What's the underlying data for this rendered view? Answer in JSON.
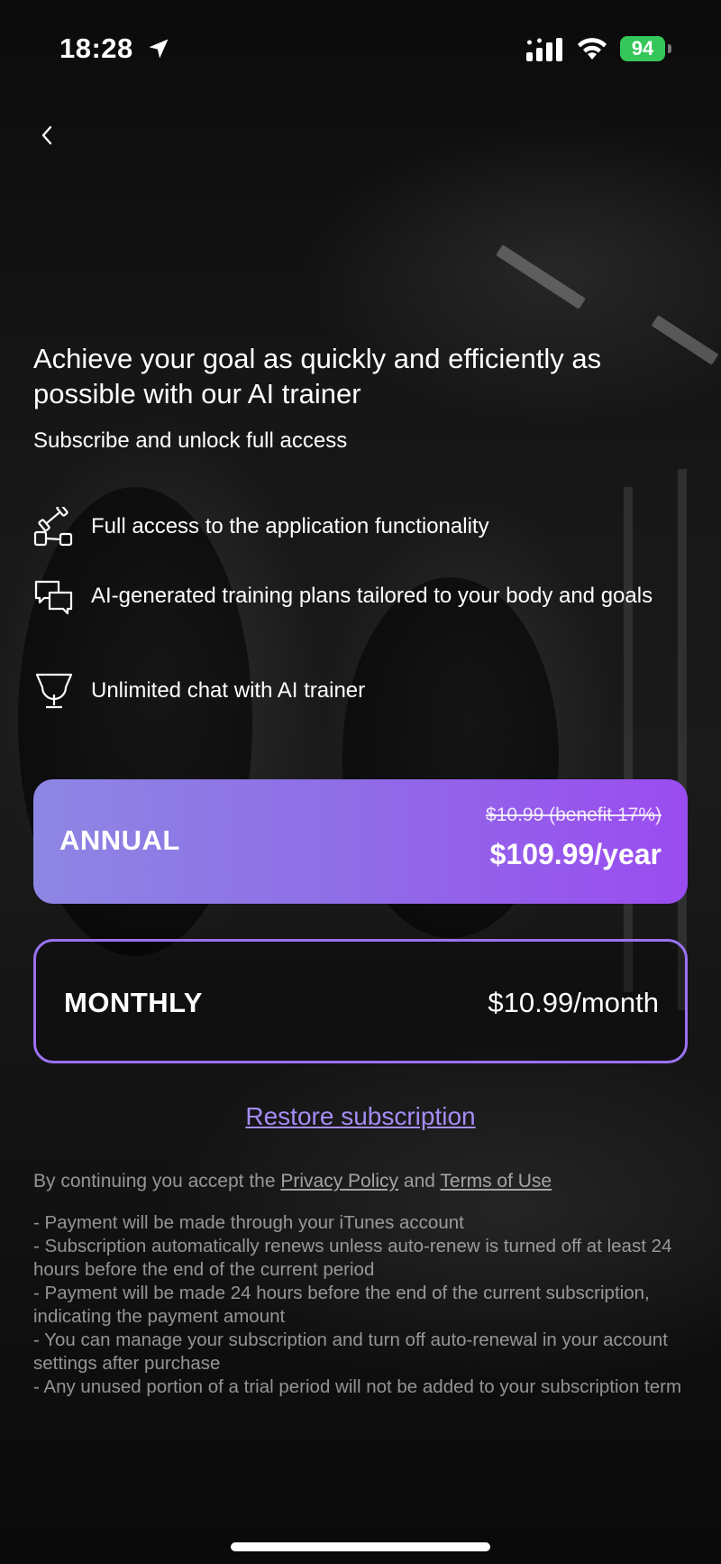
{
  "status_bar": {
    "time": "18:28",
    "battery": "94"
  },
  "header": {
    "back_icon": "chevron-left-icon"
  },
  "hero": {
    "headline": "Achieve your goal as quickly and efficiently as possible with our AI trainer",
    "subhead": "Subscribe and unlock full access"
  },
  "features": [
    {
      "icon": "dumbbell-icon",
      "text": "Full access to the application functionality"
    },
    {
      "icon": "chat-bubbles-icon",
      "text": "AI-generated training plans tailored to your body and goals"
    },
    {
      "icon": "trophy-icon",
      "text": "Unlimited chat with AI trainer"
    }
  ],
  "plans": {
    "annual": {
      "name": "ANNUAL",
      "old_price": "$10.99 (benefit 17%)",
      "price": "$109.99/year",
      "selected": true
    },
    "monthly": {
      "name": "MONTHLY",
      "price": "$10.99/month",
      "selected": false
    }
  },
  "restore_label": "Restore subscription",
  "legal": {
    "prefix": "By continuing you accept the",
    "privacy_label": "Privacy Policy",
    "and": "and",
    "terms_label": "Terms of Use"
  },
  "terms": [
    "- Payment will be made through your iTunes account",
    "- Subscription automatically renews unless auto-renew is turned off at least 24 hours before the end of the current period",
    "- Payment will be made 24 hours before the end of the current subscription, indicating the payment amount",
    "- You can manage your subscription and turn off auto-renewal in your account settings after purchase",
    "- Any unused portion of a trial period will not be added to your subscription term"
  ],
  "colors": {
    "accent_start": "#8e86e4",
    "accent_end": "#9a4cf0",
    "monthly_border": "#9a72f2",
    "battery_green": "#35c759",
    "link": "#a58cf6"
  }
}
